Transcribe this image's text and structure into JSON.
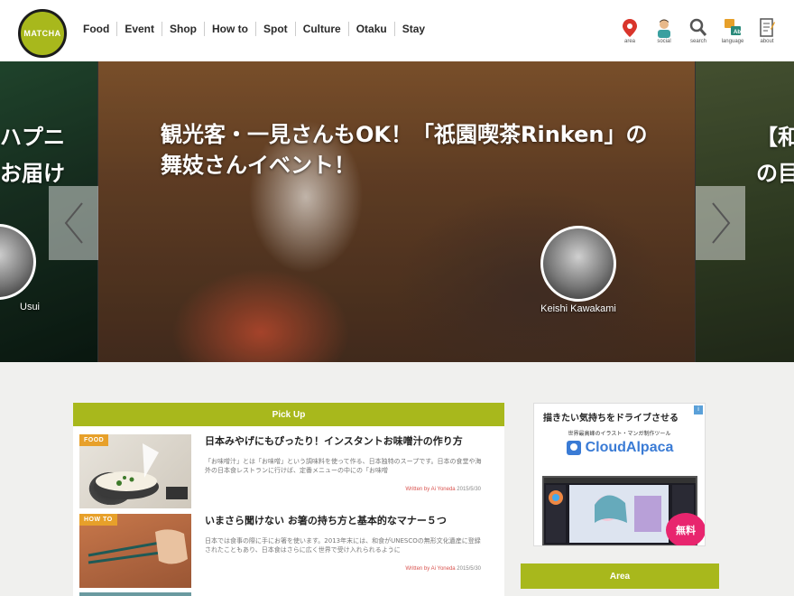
{
  "header": {
    "logo_text": "MATCHA",
    "nav": [
      "Food",
      "Event",
      "Shop",
      "How to",
      "Spot",
      "Culture",
      "Otaku",
      "Stay"
    ],
    "tools": [
      {
        "icon": "map-pin-icon",
        "label": "area"
      },
      {
        "icon": "person-icon",
        "label": "social"
      },
      {
        "icon": "search-icon",
        "label": "search"
      },
      {
        "icon": "language-icon",
        "label": "language"
      },
      {
        "icon": "document-icon",
        "label": "about"
      }
    ]
  },
  "slider": {
    "left_title_lines": [
      "ハプニ",
      "お届け"
    ],
    "left_author": "Usui",
    "main_title": "観光客・一見さんもOK！「祇園喫茶Rinken」の舞妓さんイベント！",
    "main_author": "Keishi Kawakami",
    "right_title_lines": [
      "【和",
      "の目"
    ]
  },
  "pickup": {
    "heading": "Pick Up",
    "articles": [
      {
        "tag": "FOOD",
        "title": "日本みやげにもぴったり！インスタントお味噌汁の作り方",
        "excerpt": "「お味噌汁」とは「お味噌」という調味料を使って作る、日本独特のスープです。日本の食堂や海外の日本食レストランに行けば、定番メニューの中にの「お味噌",
        "author": "Written by Ai Yoneda",
        "date": "2015/5/30"
      },
      {
        "tag": "HOW TO",
        "title": "いまさら聞けない お箸の持ち方と基本的なマナー５つ",
        "excerpt": "日本では食事の際に手にお箸を使います。2013年末には、和食がUNESCOの無形文化遺産に登録されたこともあり、日本食はさらに広く世界で受け入れられるように",
        "author": "Written by Ai Yoneda",
        "date": "2015/5/30"
      }
    ]
  },
  "ad": {
    "headline": "描きたい気持ちをドライブさせる",
    "subline": "世界最高峰のイラスト・マンガ制作ツール",
    "brand": "CloudAlpaca",
    "badge": "無料"
  },
  "sidebar": {
    "area_heading": "Area"
  },
  "colors": {
    "accent": "#a8b81c",
    "tag": "#e7a02a",
    "author": "#d9534f",
    "badge": "#e8256e"
  }
}
